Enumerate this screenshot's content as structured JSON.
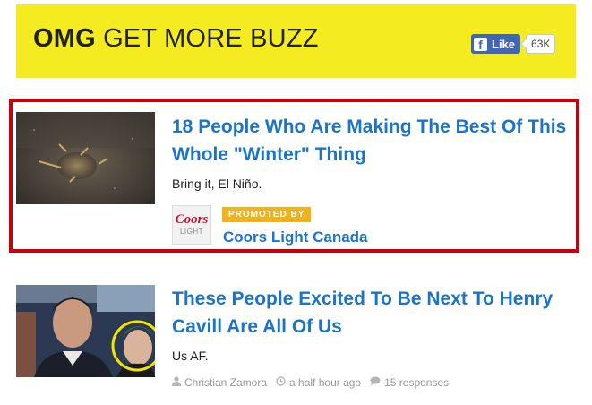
{
  "header": {
    "title_bold": "OMG",
    "title_rest": " GET MORE BUZZ",
    "like_label": "Like",
    "like_count": "63K",
    "banner_color": "#f4ec20"
  },
  "promo_card": {
    "headline": "18 People Who Are Making The Best Of This Whole \"Winter\" Thing",
    "description": "Bring it, El Niño.",
    "promoted_label": "PROMOTED BY",
    "sponsor_name": "Coors Light Canada",
    "sponsor_logo_text_top": "Coors",
    "sponsor_logo_text_bottom": "LIGHT",
    "border_color": "#c8000c"
  },
  "article_card": {
    "headline": "These People Excited To Be Next To Henry Cavill Are All Of Us",
    "description": "Us AF.",
    "author": "Christian Zamora",
    "time": "a half hour ago",
    "responses": "15 responses"
  },
  "colors": {
    "link": "#1c74c4",
    "promoted_badge": "#f2b21c",
    "facebook": "#4267b2"
  }
}
